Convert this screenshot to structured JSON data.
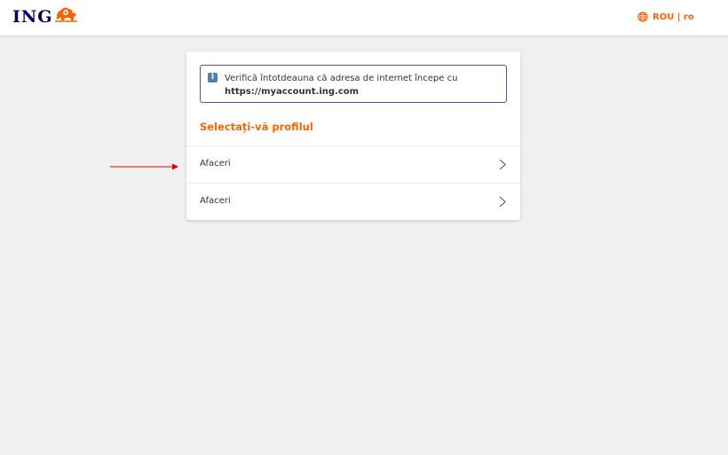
{
  "header": {
    "logo_text": "ING",
    "language_label": "ROU | ro",
    "brand_color": "#ff6200",
    "logo_color": "#000066"
  },
  "notice": {
    "text": "Verifică întotdeauna că adresa de internet începe cu",
    "url": "https://myaccount.ing.com"
  },
  "profile": {
    "title": "Selectați-vă profilul",
    "items": [
      {
        "label": "Afaceri"
      },
      {
        "label": "Afaceri"
      }
    ]
  }
}
